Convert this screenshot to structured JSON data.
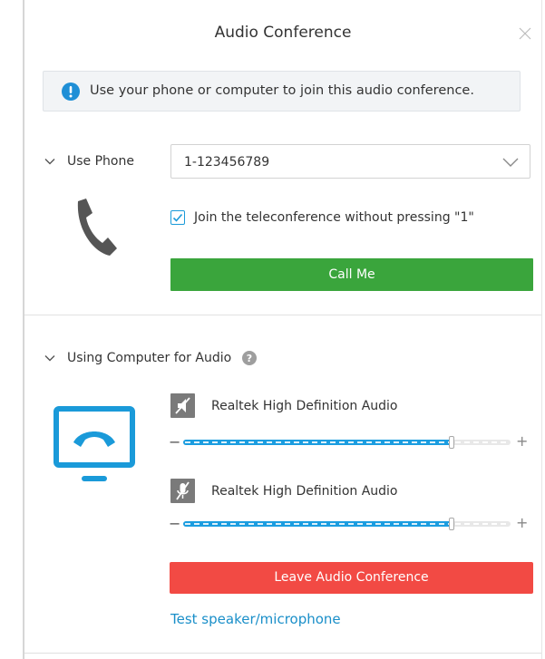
{
  "dialog": {
    "title": "Audio Conference",
    "close_icon": "close-icon"
  },
  "banner": {
    "icon": "info-icon",
    "text": "Use your phone or computer to join this audio conference."
  },
  "phone": {
    "header": "Use Phone",
    "number": "1-123456789",
    "checkbox_label": "Join the teleconference without pressing \"1\"",
    "checkbox_checked": true,
    "call_button": "Call Me"
  },
  "computer": {
    "header": "Using Computer for Audio",
    "speaker": {
      "name": "Realtek High Definition Audio",
      "icon": "speaker-muted-icon",
      "volume_fraction": 0.82
    },
    "microphone": {
      "name": "Realtek High Definition Audio",
      "icon": "microphone-muted-icon",
      "volume_fraction": 0.82
    },
    "leave_button": "Leave Audio Conference",
    "test_link": "Test speaker/microphone",
    "minus": "−",
    "plus": "+"
  },
  "colors": {
    "accent_blue": "#1b9de0",
    "call_green": "#3aa53c",
    "leave_red": "#f24a44",
    "link_blue": "#1a8fc9",
    "info_blue": "#1f8fd6"
  }
}
